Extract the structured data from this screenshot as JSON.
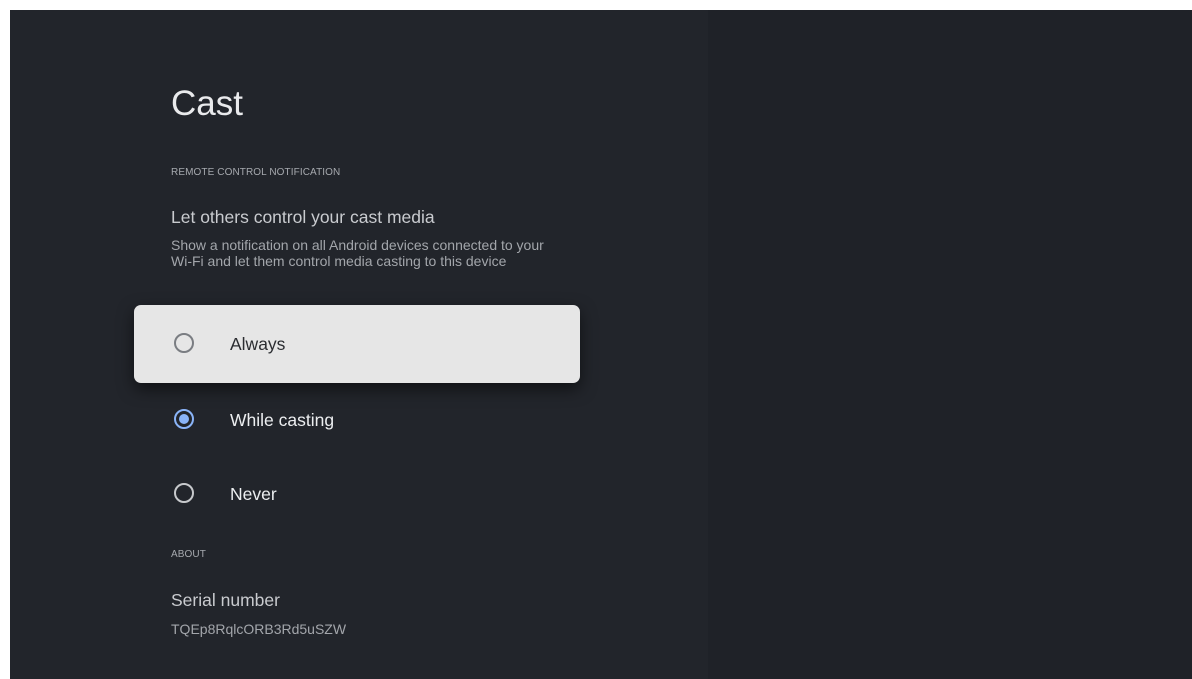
{
  "page": {
    "title": "Cast"
  },
  "remote_control": {
    "section_header": "REMOTE CONTROL NOTIFICATION",
    "preference_title": "Let others control your cast media",
    "preference_summary": "Show a notification on all Android devices connected to your Wi-Fi and let them control media casting to this device",
    "options": [
      {
        "label": "Always",
        "checked": false,
        "focused": true
      },
      {
        "label": "While casting",
        "checked": true,
        "focused": false
      },
      {
        "label": "Never",
        "checked": false,
        "focused": false
      }
    ]
  },
  "about": {
    "section_header": "ABOUT",
    "serial_title": "Serial number",
    "serial_value": "TQEp8RqlcORB3Rd5uSZW"
  },
  "colors": {
    "background": "#22252b",
    "focus_card": "#e6e6e6",
    "accent": "#8ab4f8"
  },
  "icons": {
    "radio_unchecked": "radio-unchecked-icon",
    "radio_checked": "radio-checked-icon"
  }
}
